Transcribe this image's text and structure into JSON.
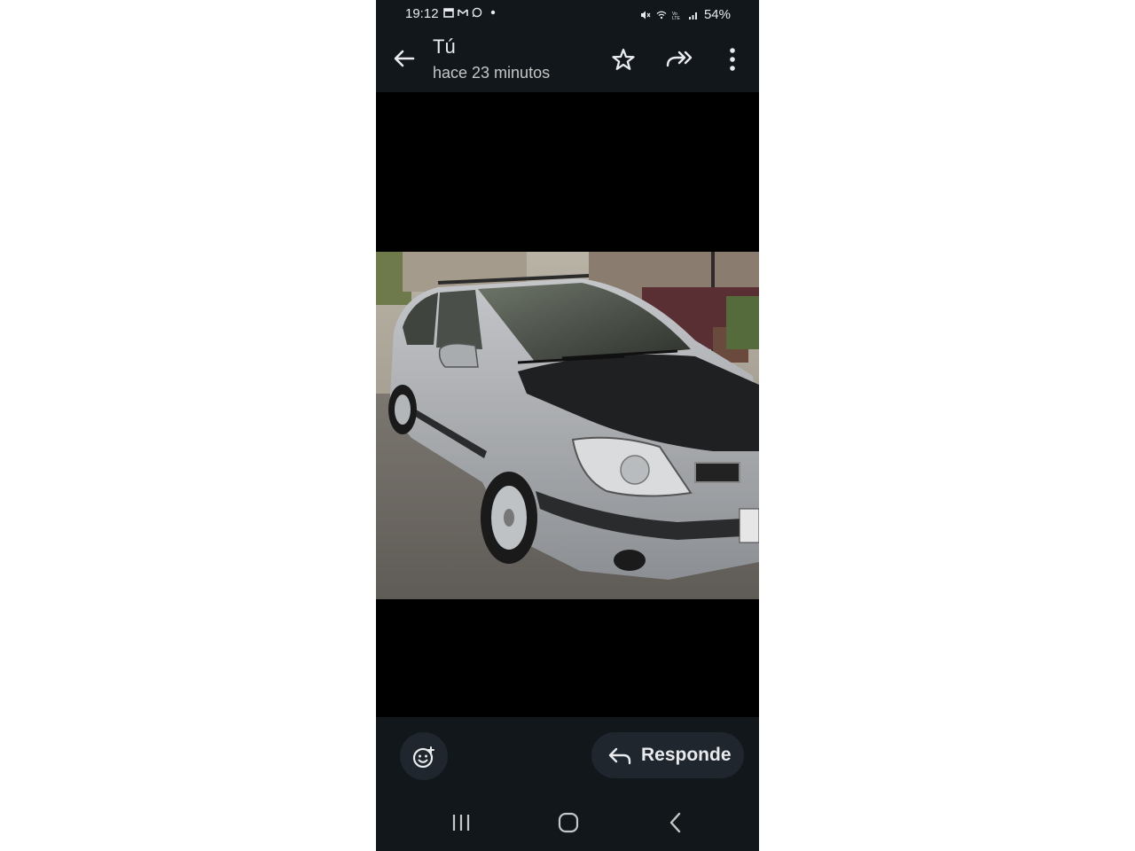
{
  "status_bar": {
    "time": "19:12",
    "battery": "54%",
    "icons_left": [
      "calendar-icon",
      "gmail-icon",
      "whatsapp-icon",
      "dot-icon"
    ],
    "icons_right": [
      "mute-icon",
      "wifi-icon",
      "volte-icon",
      "signal-icon",
      "battery-icon"
    ]
  },
  "header": {
    "sender": "Tú",
    "time_ago": "hace 23 minutos",
    "actions": [
      "back-arrow-icon",
      "star-icon",
      "forward-icon",
      "more-vert-icon"
    ]
  },
  "message": {
    "image_description_icon": "photo-of-silver-hatchback-car"
  },
  "bottom": {
    "emoji_icon": "add-reaction-icon",
    "reply_label": "Responde",
    "reply_icon": "reply-arrow-icon"
  },
  "colors": {
    "bar_bg": "#12171c",
    "button_bg": "#1f262d",
    "text": "#e8eaed"
  }
}
